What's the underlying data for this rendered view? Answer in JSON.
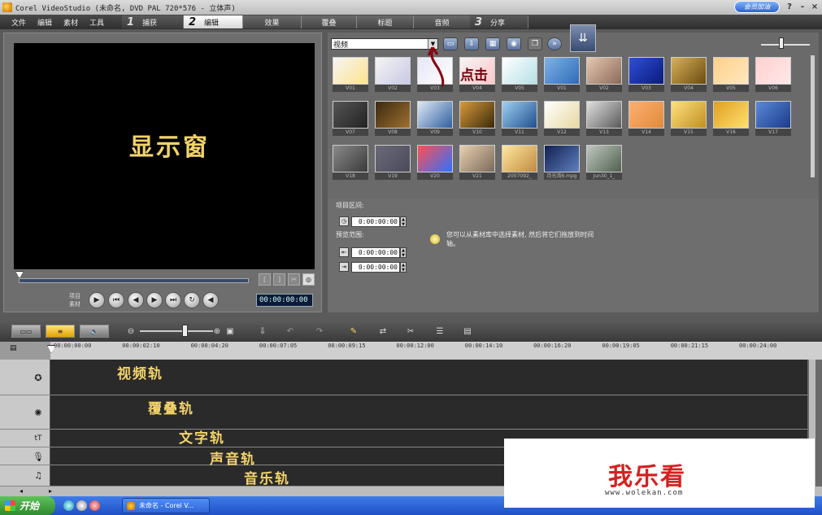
{
  "window": {
    "title": "Corel VideoStudio (未命名, DVD PAL 720*576 - 立体声)",
    "badge": "会员加油",
    "help": "?",
    "minimize": "-",
    "close": "×"
  },
  "menu": {
    "file": "文件",
    "edit": "编辑",
    "clip": "素材",
    "tools": "工具"
  },
  "steps": [
    {
      "num": "1",
      "label": "捕获"
    },
    {
      "num": "2",
      "label": "编辑"
    },
    {
      "num": "3",
      "label": "分享"
    }
  ],
  "tabs": {
    "effects": "效果",
    "overlay": "覆叠",
    "title": "标题",
    "audio": "音频"
  },
  "preview": {
    "screen_label": "显示窗",
    "mode_project": "项目",
    "mode_clip": "素材",
    "timecode": "00:00:00:00"
  },
  "library": {
    "category": "视频",
    "callout": "点击",
    "items": [
      {
        "id": "V01",
        "colors": [
          "#f5f5f5",
          "#ffe38a"
        ]
      },
      {
        "id": "V02",
        "colors": [
          "#f4f4f4",
          "#c9c9e6"
        ]
      },
      {
        "id": "V03",
        "colors": [
          "#e6e6f6",
          "#ffffff"
        ]
      },
      {
        "id": "V04",
        "colors": [
          "#f4f4f4",
          "#ffc8c8"
        ]
      },
      {
        "id": "V05",
        "colors": [
          "#ffffff",
          "#b5e1e6"
        ]
      },
      {
        "id": "V01",
        "colors": [
          "#7fb3e6",
          "#2e6ab8"
        ]
      },
      {
        "id": "V02",
        "colors": [
          "#e6c8b0",
          "#8a6a5a"
        ]
      },
      {
        "id": "V03",
        "colors": [
          "#2f4fd8",
          "#0a1a7a"
        ]
      },
      {
        "id": "V04",
        "colors": [
          "#d8b25a",
          "#6a4a10"
        ]
      },
      {
        "id": "V05",
        "colors": [
          "#ffcf8a",
          "#ffe8c0"
        ]
      },
      {
        "id": "V06",
        "colors": [
          "#ffd0d0",
          "#ffe8e8"
        ]
      },
      {
        "id": "V07",
        "colors": [
          "#555555",
          "#222222"
        ]
      },
      {
        "id": "V08",
        "colors": [
          "#3a2a10",
          "#a07030"
        ]
      },
      {
        "id": "V09",
        "colors": [
          "#dfeaf6",
          "#2f5f9f"
        ]
      },
      {
        "id": "V10",
        "colors": [
          "#d89a3a",
          "#3a2a0a"
        ]
      },
      {
        "id": "V11",
        "colors": [
          "#9fd0f0",
          "#1f4f8f"
        ]
      },
      {
        "id": "V12",
        "colors": [
          "#ffffff",
          "#e8d8a0"
        ]
      },
      {
        "id": "V13",
        "colors": [
          "#e0e0e0",
          "#5a5a5a"
        ]
      },
      {
        "id": "V14",
        "colors": [
          "#ffb070",
          "#e08a3a"
        ]
      },
      {
        "id": "V15",
        "colors": [
          "#ffe080",
          "#c09020"
        ]
      },
      {
        "id": "V16",
        "colors": [
          "#e0a020",
          "#ffe070"
        ]
      },
      {
        "id": "V17",
        "colors": [
          "#5a8ad8",
          "#1a3a8a"
        ]
      },
      {
        "id": "V18",
        "colors": [
          "#8a8a8a",
          "#3a3a3a"
        ]
      },
      {
        "id": "V19",
        "colors": [
          "#6a6a7a",
          "#4a4a5a"
        ]
      },
      {
        "id": "V20",
        "colors": [
          "#ff5050",
          "#3070ff"
        ]
      },
      {
        "id": "V21",
        "colors": [
          "#e8d0b0",
          "#7a6a5a"
        ]
      },
      {
        "id": "2007092_",
        "colors": [
          "#ffe8a0",
          "#c08a40"
        ]
      },
      {
        "id": "月光湾6.mpg",
        "colors": [
          "#102050",
          "#6080c0"
        ]
      },
      {
        "id": "Jun30_1_",
        "colors": [
          "#c0c8c0",
          "#506050"
        ]
      }
    ]
  },
  "options": {
    "project_duration_label": "项目区间:",
    "preview_range_label": "预览范围:",
    "duration": "0:00:00:00",
    "range_start": "0:00:00:00",
    "range_end": "0:00:00:00",
    "hint": "您可以从素材库中选择素材, 然后将它们拖放到时间轴。"
  },
  "ruler": {
    "ticks": [
      "00:00:00:00",
      "00:00:02:10",
      "00:00:04:20",
      "00:00:07:05",
      "00:00:09:15",
      "00:00:12:00",
      "00:00:14:10",
      "00:00:16:20",
      "00:00:19:05",
      "00:00:21:15",
      "00:00:24:00"
    ]
  },
  "tracks": {
    "video": "视频轨",
    "overlay": "覆叠轨",
    "title": "文字轨",
    "voice": "声音轨",
    "music": "音乐轨"
  },
  "taskbar": {
    "start": "开始",
    "task": "未命名 - Corel V..."
  },
  "watermark": {
    "brand": "我乐看",
    "url": "www.wolekan.com"
  }
}
